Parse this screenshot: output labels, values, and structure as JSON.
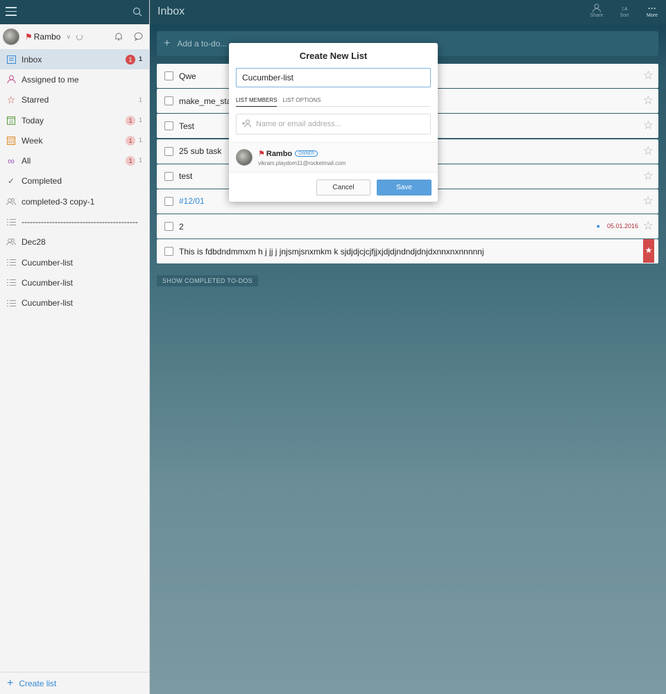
{
  "sidebar": {
    "user_name": "Rambo",
    "items": [
      {
        "label": "Inbox",
        "badge": "1",
        "count": "1",
        "icon": "inbox-icon"
      },
      {
        "label": "Assigned to me",
        "icon": "person-icon"
      },
      {
        "label": "Starred",
        "count": "1",
        "icon": "star-icon"
      },
      {
        "label": "Today",
        "badge": "1",
        "count": "1",
        "icon": "calendar-today-icon"
      },
      {
        "label": "Week",
        "badge": "1",
        "count": "1",
        "icon": "calendar-week-icon"
      },
      {
        "label": "All",
        "badge": "1",
        "count": "1",
        "icon": "infinity-icon"
      },
      {
        "label": "Completed",
        "icon": "checkmark-icon"
      },
      {
        "label": "completed-3 copy-1",
        "icon": "shared-list-icon"
      },
      {
        "label": "-------------------------------------------...",
        "icon": "list-icon"
      },
      {
        "label": "Dec28",
        "icon": "shared-list-icon"
      },
      {
        "label": "Cucumber-list",
        "icon": "list-icon"
      },
      {
        "label": "Cucumber-list",
        "icon": "list-icon"
      },
      {
        "label": "Cucumber-list",
        "icon": "list-icon"
      }
    ],
    "create_list": "Create list"
  },
  "header": {
    "title": "Inbox",
    "share": "Share",
    "sort": "Sort",
    "more": "More"
  },
  "add_todo": {
    "placeholder": "Add a to-do..."
  },
  "tasks": [
    {
      "title": "Qwe"
    },
    {
      "title": "make_me_star"
    },
    {
      "title": "Test"
    },
    {
      "title": "25 sub task"
    },
    {
      "title": "test"
    },
    {
      "title": "#12/01"
    },
    {
      "title": "2",
      "due": "05.01.2016"
    },
    {
      "title": "This is fdbdndmmxm h j jj j jnjsmjsnxmkm k sjdjdjcjcjfjjxjdjdjndndjdnjdxnnxnxnnnnnj"
    }
  ],
  "show_completed": "SHOW COMPLETED TO-DOS",
  "modal": {
    "title": "Create New List",
    "list_name_value": "Cucumber-list",
    "tab_members": "LIST MEMBERS",
    "tab_options": "LIST OPTIONS",
    "member_placeholder": "Name or email address...",
    "member_name": "Rambo",
    "member_badge": "OWNER",
    "member_email": "vikram.playdom11@rocketmail.com",
    "cancel": "Cancel",
    "save": "Save"
  },
  "colors": {
    "accent": "#328ad6",
    "badge": "#d34a4a",
    "header": "#1e4a5a",
    "save_button": "#5aa0dc"
  }
}
